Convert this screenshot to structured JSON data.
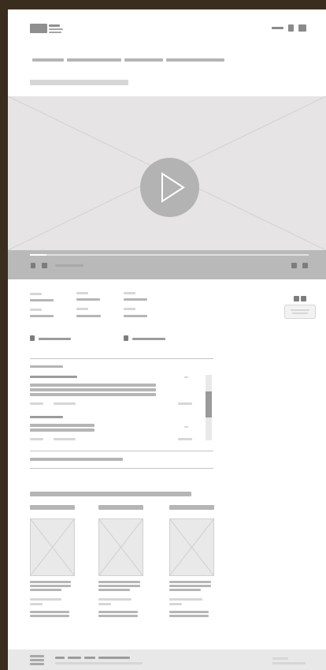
{
  "screen": {
    "kind": "wireframe-mockup",
    "colors": {
      "background": "#3a2d1d",
      "page": "#ffffff",
      "placeholder": "#c8c8c8",
      "video_area": "#e6e4e4",
      "video_controls": "#b9b9b9",
      "play_button": "#b3b3b3"
    }
  },
  "header": {
    "logo_icon": "logo-icon",
    "menu_icons": [
      "minus-icon",
      "square-icon",
      "square-icon"
    ]
  },
  "nav": {
    "tabs": [
      "",
      "",
      "",
      ""
    ]
  },
  "title": {
    "text": ""
  },
  "video": {
    "play_icon": "play-icon",
    "progress": 0.06,
    "controls_icons": [
      "play-control-icon",
      "volume-icon",
      "settings-icon",
      "fullscreen-icon"
    ]
  },
  "details": {
    "rows": 3,
    "columns": 3,
    "toggle_icon": "grid-toggle-icon"
  },
  "legend": {
    "items": [
      "",
      ""
    ]
  },
  "comments": {
    "scrollbar_position": 0.3
  },
  "related": {
    "cards": 3
  },
  "footer": {
    "icon": "menu-icon"
  }
}
